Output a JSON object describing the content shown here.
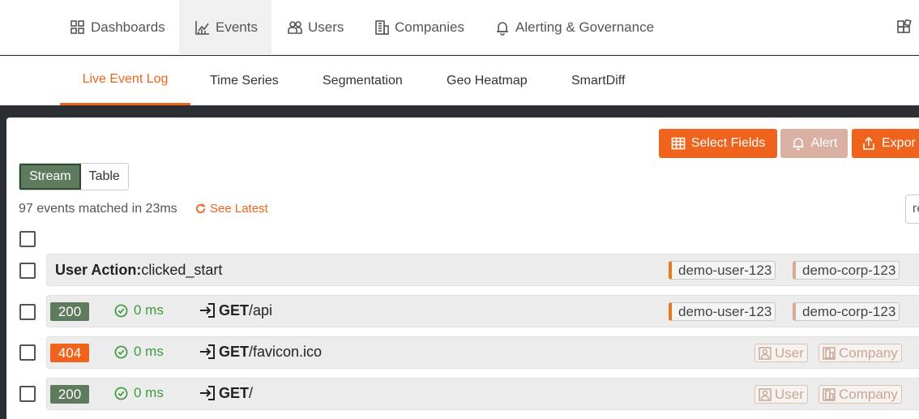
{
  "topnav": {
    "items": [
      {
        "label": "Dashboards",
        "icon": "dashboard-grid-icon"
      },
      {
        "label": "Events",
        "icon": "chart-icon",
        "active": true
      },
      {
        "label": "Users",
        "icon": "users-icon"
      },
      {
        "label": "Companies",
        "icon": "building-icon"
      },
      {
        "label": "Alerting & Governance",
        "icon": "bell-icon"
      }
    ],
    "right_icon": "apps-icon"
  },
  "subnav": {
    "tabs": [
      {
        "label": "Live Event Log",
        "active": true
      },
      {
        "label": "Time Series"
      },
      {
        "label": "Segmentation"
      },
      {
        "label": "Geo Heatmap"
      },
      {
        "label": "SmartDiff"
      }
    ]
  },
  "toolbar": {
    "select_fields": "Select Fields",
    "alert": "Alert",
    "export": "Expor"
  },
  "view_toggle": {
    "stream": "Stream",
    "table": "Table"
  },
  "summary": {
    "matched_text": "97 events matched in 23ms",
    "see_latest": "See Latest",
    "right_box_text": "re"
  },
  "events": [
    {
      "type": "action",
      "label_bold": "User Action:",
      "label_rest": "clicked_start",
      "user": "demo-user-123",
      "company": "demo-corp-123"
    },
    {
      "type": "request",
      "status": "200",
      "duration": "0 ms",
      "method": "GET",
      "path": "/api",
      "user": "demo-user-123",
      "company": "demo-corp-123"
    },
    {
      "type": "request",
      "status": "404",
      "duration": "0 ms",
      "method": "GET",
      "path": "/favicon.ico",
      "user_placeholder": "User",
      "company_placeholder": "Company"
    },
    {
      "type": "request",
      "status": "200",
      "duration": "0 ms",
      "method": "GET",
      "path": "/",
      "user_placeholder": "User",
      "company_placeholder": "Company"
    }
  ],
  "colors": {
    "accent": "#f0631d",
    "success": "#5e7b5d",
    "duration": "#3f9a3f"
  }
}
